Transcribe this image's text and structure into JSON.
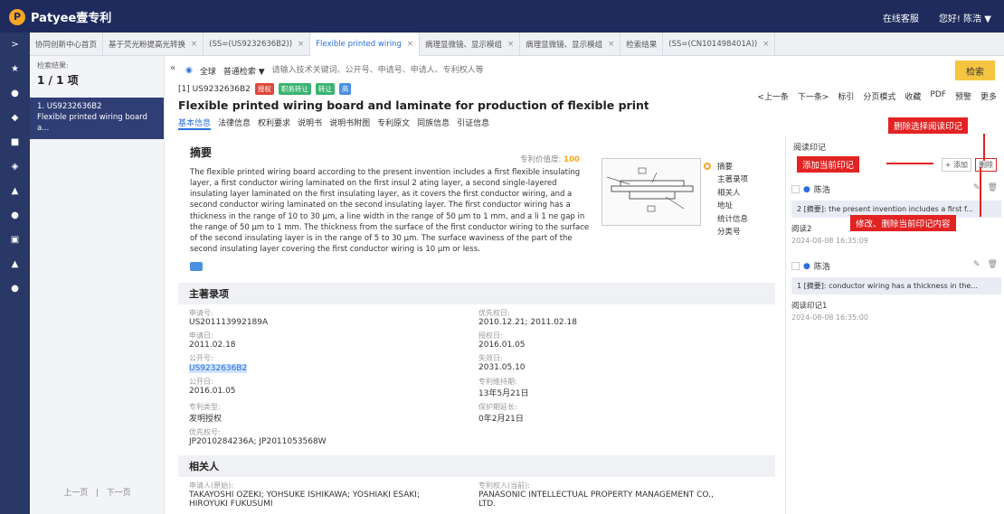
{
  "app": {
    "brand": "Patyee壹专利",
    "service": "在线客服",
    "greeting": "您好! 陈浩 ▼"
  },
  "leftnav": [
    ">",
    "★",
    "●",
    "◆",
    "■",
    "◈",
    "▲",
    "●",
    "▣",
    "▲",
    "●"
  ],
  "tabs": [
    {
      "label": "协同创新中心首页",
      "closable": false,
      "active": false
    },
    {
      "label": "基于荧光粉提高光转换",
      "closable": true,
      "active": false
    },
    {
      "label": "(SS=(US9232636B2))",
      "closable": true,
      "active": false
    },
    {
      "label": "Flexible printed wiring",
      "closable": true,
      "active": true
    },
    {
      "label": "病理显微镜、显示模组",
      "closable": true,
      "active": false
    },
    {
      "label": "病理显微镜、显示模组",
      "closable": true,
      "active": false
    },
    {
      "label": "检索结果",
      "closable": false,
      "active": false
    },
    {
      "label": "(SS=(CN101498401A))",
      "closable": true,
      "active": false
    }
  ],
  "results": {
    "label": "检索结果:",
    "count": "1 / 1 项",
    "item_no": "1. US9232636B2",
    "item_title": "Flexible printed wiring board a...",
    "prev": "上一页",
    "next": "下一页"
  },
  "search": {
    "scope": "全球",
    "mode": "普通检索 ▼",
    "placeholder": "请输入技术关键词、公开号、申请号、申请人、专利权人等",
    "button": "检索"
  },
  "doc": {
    "number": "[1] US9232636B2",
    "badges": [
      "授权",
      "职务转让",
      "转让",
      "高"
    ],
    "title": "Flexible printed wiring board and laminate for production of flexible printed wiring bo...",
    "subnav": [
      "基本信息",
      "法律信息",
      "权利要求",
      "说明书",
      "说明书附图",
      "专利原文",
      "同族信息",
      "引证信息"
    ],
    "tools": [
      "<上一条",
      "下一条>",
      "标引",
      "分页模式",
      "收藏",
      "PDF",
      "预警",
      "更多"
    ]
  },
  "abstract": {
    "title": "摘要",
    "score_label": "专利价值度:",
    "score": "100",
    "text": "The flexible printed wiring board according to the present invention includes a first flexible insulating layer, a first conductor wiring laminated on the first insul 2 ating layer, a second single-layered insulating layer laminated on the first insulating layer, as it covers the first conductor wiring, and a second conductor wiring laminated on the second insulating layer. The first conductor wiring has a thickness in the range of 10 to 30 μm, a line width in the range of 50 μm to 1 mm, and a li 1 ne gap in the range of 50 μm to 1 mm. The thickness from the surface of the first conductor wiring to the surface of the second insulating layer is in the range of 5 to 30 μm. The surface waviness of the part of the second insulating layer covering the first conductor wiring is 10 μm or less."
  },
  "toc": [
    "摘要",
    "主著录项",
    "相关人",
    "地址",
    "统计信息",
    "分类号"
  ],
  "biblio": {
    "title": "主著录项",
    "fields": [
      {
        "label": "申请号:",
        "value": "US201113992189A"
      },
      {
        "label": "优先权日:",
        "value": "2010.12.21; 2011.02.18"
      },
      {
        "label": "申请日:",
        "value": "2011.02.18"
      },
      {
        "label": "授权日:",
        "value": "2016.01.05"
      },
      {
        "label": "公开号:",
        "value": "US9232636B2"
      },
      {
        "label": "失效日:",
        "value": "2031.05.10"
      },
      {
        "label": "公开日:",
        "value": "2016.01.05"
      },
      {
        "label": "专利维持期:",
        "value": "13年5月21日"
      },
      {
        "label": "专利类型:",
        "value": "发明授权"
      },
      {
        "label": "保护期延长:",
        "value": "0年2月21日"
      },
      {
        "label": "优先权号:",
        "value": "JP2010284236A; JP2011053568W"
      }
    ],
    "related_title": "相关人",
    "applicant_label": "申请人(原始):",
    "applicant": "TAKAYOSHI OZEKI; YOHSUKE ISHIKAWA; YOSHIAKI ESAKI; HIROYUKI FUKUSUMI",
    "owner_label": "专利权人(当前):",
    "owner": "PANASONIC INTELLECTUAL PROPERTY MANAGEMENT CO., LTD."
  },
  "notes_panel": {
    "title": "阅读印记",
    "add": "+ 添加",
    "delete": "删除",
    "notes": [
      {
        "user": "陈浩",
        "num": "2",
        "quote": "[摘要]: the present invention includes a first f...",
        "text": "阅读2",
        "time": "2024-08-08 16:35:09"
      },
      {
        "user": "陈浩",
        "num": "1",
        "quote": "[摘要]: conductor wiring has a thickness in the...",
        "text": "阅读印记1",
        "time": "2024-08-08 16:35:00"
      }
    ]
  },
  "callouts": {
    "delete_selected": "删除选择阅读印记",
    "add_current": "添加当前印记",
    "edit_current": "修改、删除当前印记内容"
  }
}
